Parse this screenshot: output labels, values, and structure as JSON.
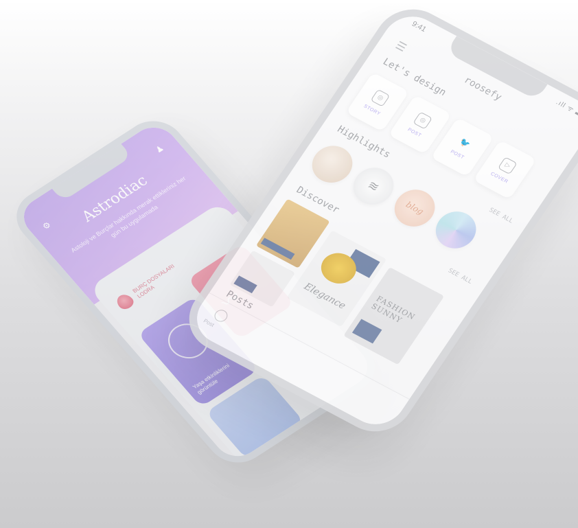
{
  "back_app": {
    "title": "Astrodiac",
    "tagline": "Astoloji ve Burçlar hakkında merak ettikleriniz her gün bu uygulamada",
    "burc_label": "BURÇ DOSYALARI LODRA",
    "card_label": "Yaşa etkinliklerini görüntüle"
  },
  "front_app": {
    "status_time": "9:41",
    "status_icons": ".ıll ᯤ ▬",
    "title": "roosefy",
    "sections": {
      "design": "Let's design",
      "highlights": "Highlights",
      "discover": "Discover",
      "posts": "Posts"
    },
    "see_all": "SEE ALL",
    "design_items": [
      {
        "icon": "instagram-icon",
        "glyph": "◎",
        "label": "STORY"
      },
      {
        "icon": "instagram-icon",
        "glyph": "◎",
        "label": "POST"
      },
      {
        "icon": "twitter-icon",
        "glyph": "🐦",
        "label": "POST"
      },
      {
        "icon": "youtube-icon",
        "glyph": "▷",
        "label": "COVER"
      }
    ],
    "highlight_script": "blog",
    "discover_titles": {
      "elegance": "Elegance",
      "fashion": "FASHION SUNNY"
    },
    "tab_label": "Post"
  }
}
